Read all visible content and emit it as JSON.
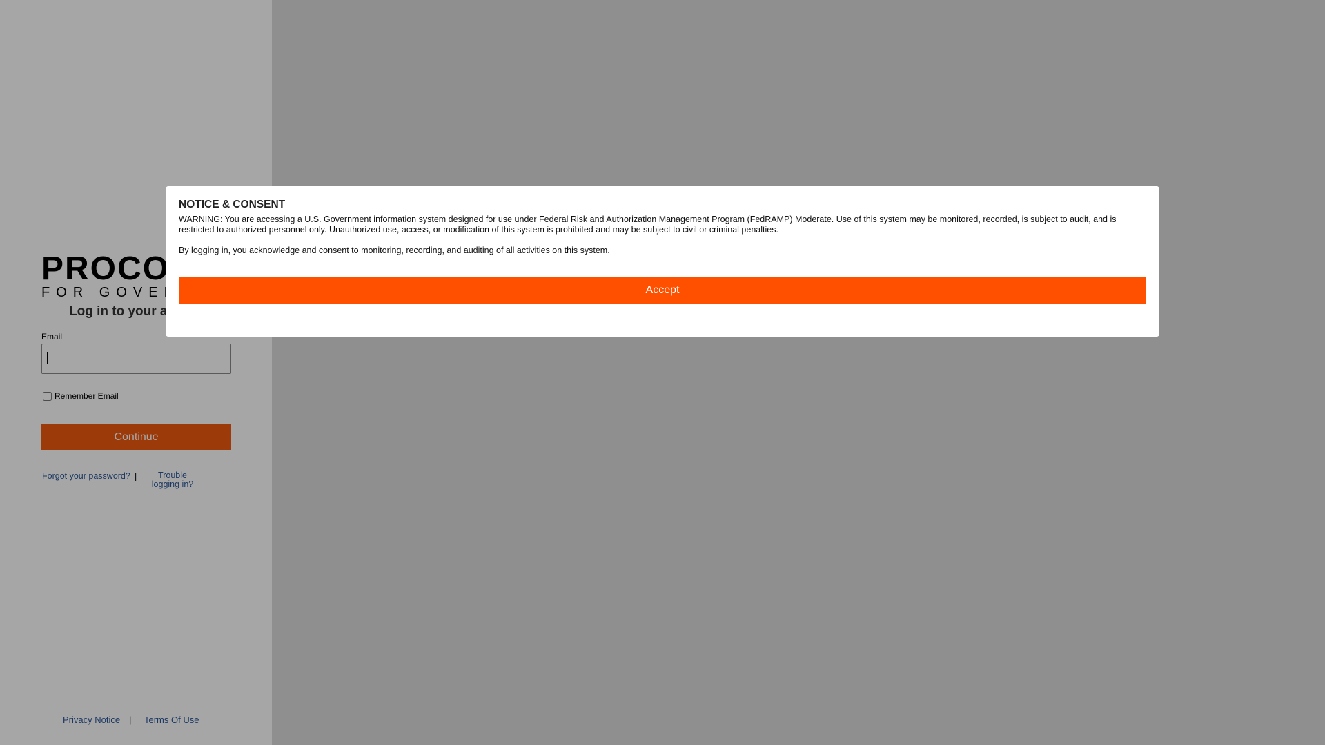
{
  "colors": {
    "brand_orange": "#ff5000",
    "link_blue": "#2b5797",
    "backdrop": "rgba(0,0,0,0.35)"
  },
  "logo": {
    "main": "PROCORE",
    "sub": "FOR GOVERNMENT"
  },
  "login": {
    "heading": "Log in to your account",
    "email_label": "Email",
    "email_value": "",
    "remember_label": "Remember Email",
    "remember_checked": false,
    "continue_label": "Continue",
    "forgot_label": "Forgot your password?",
    "separator": "|",
    "trouble_label": "Trouble logging in?"
  },
  "footer": {
    "privacy_label": "Privacy Notice",
    "separator": "|",
    "terms_label": "Terms Of Use"
  },
  "modal": {
    "title": "NOTICE & CONSENT",
    "warning": "WARNING: You are accessing a U.S. Government information system designed for use under Federal Risk and Authorization Management Program (FedRAMP) Moderate. Use of this system may be monitored, recorded, is subject to audit, and is restricted to authorized personnel only. Unauthorized use, access, or modification of this system is prohibited and may be subject to civil or criminal penalties.",
    "consent": "By logging in, you acknowledge and consent to monitoring, recording, and auditing of all activities on this system.",
    "accept_label": "Accept"
  }
}
